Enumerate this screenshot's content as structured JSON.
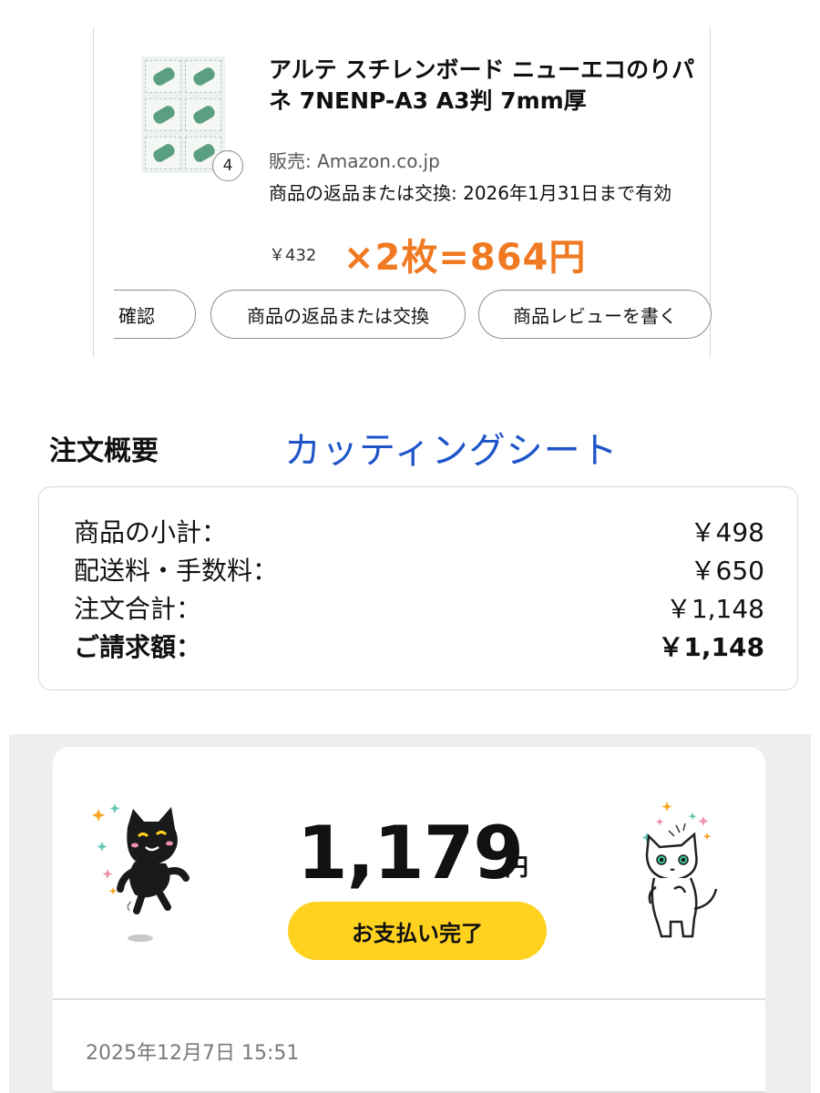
{
  "product": {
    "title": "アルテ スチレンボード ニューエコのりパネ 7NENP-A3 A3判 7mm厚",
    "seller": "販売: Amazon.co.jp",
    "return_note": "商品の返品または交換: 2026年1月31日まで有効",
    "price": "￥432",
    "quantity_badge": "4",
    "annotation": "×2枚=864円",
    "buttons": [
      "確認",
      "商品の返品または交換",
      "商品レビューを書く"
    ]
  },
  "summary": {
    "heading": "注文概要",
    "annotation": "カッティングシート",
    "rows": [
      {
        "label": "商品の小計：",
        "value": "￥498"
      },
      {
        "label": "配送料・手数料：",
        "value": "￥650"
      },
      {
        "label": "注文合計：",
        "value": "￥1,148"
      },
      {
        "label": "ご請求額：",
        "value": "￥1,148"
      }
    ]
  },
  "payment": {
    "amount": "1,179",
    "unit": "円",
    "status": "お支払い完了",
    "timestamp": "2025年12月7日 15:51"
  },
  "colors": {
    "annotation_orange": "#f07a22",
    "annotation_blue": "#1f55c9",
    "paid_yellow": "#ffd21f"
  }
}
